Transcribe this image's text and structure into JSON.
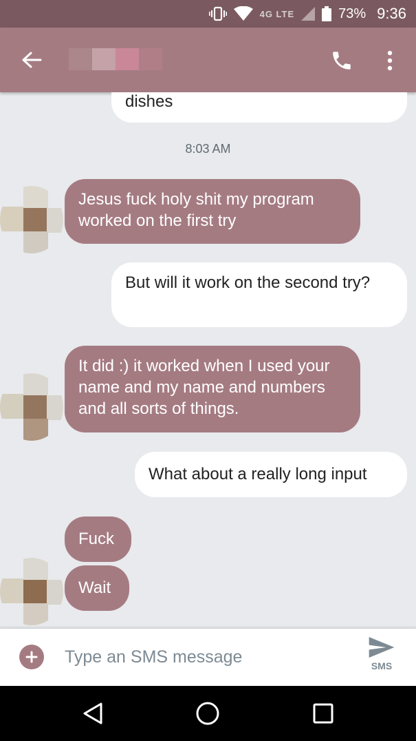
{
  "status_bar": {
    "network": "4G LTE",
    "battery": "73%",
    "time": "9:36"
  },
  "app_bar": {
    "back_icon": "arrow-left-icon",
    "call_icon": "phone-icon",
    "more_icon": "more-vert-icon"
  },
  "conversation": {
    "timestamp": "8:03 AM",
    "messages": [
      {
        "direction": "sent",
        "text": "dishes"
      },
      {
        "direction": "received",
        "text": "Jesus fuck holy shit my program worked on the first try"
      },
      {
        "direction": "sent",
        "text": "But will it work on the second try?"
      },
      {
        "direction": "received",
        "text": "It did :) it worked when I used your name and my name and numbers and all sorts of things."
      },
      {
        "direction": "sent",
        "text": "What about a really long input"
      },
      {
        "direction": "received",
        "text": "Fuck"
      },
      {
        "direction": "received",
        "text": "Wait"
      }
    ]
  },
  "composer": {
    "placeholder": "Type an SMS message",
    "send_label": "SMS"
  },
  "colors": {
    "accent": "#a57b82",
    "status_bar": "#7a5a60",
    "background": "#e8eaed"
  }
}
